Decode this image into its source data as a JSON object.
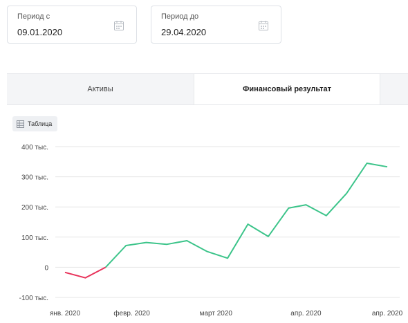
{
  "filters": {
    "from": {
      "label": "Период с",
      "value": "09.01.2020"
    },
    "to": {
      "label": "Период до",
      "value": "29.04.2020"
    }
  },
  "tabs": [
    {
      "label": "Активы",
      "active": false
    },
    {
      "label": "Финансовый результат",
      "active": true
    },
    {
      "label": "",
      "active": false
    }
  ],
  "table_button": {
    "label": "Таблица",
    "icon": "table-icon"
  },
  "colors": {
    "positive": "#3cc48a",
    "negative": "#e8325a",
    "grid": "#e5e5e5"
  },
  "chart_data": {
    "type": "line",
    "title": "",
    "xlabel": "",
    "ylabel": "",
    "ylim": [
      -100000,
      400000
    ],
    "y_ticks": [
      {
        "value": 400000,
        "label": "400 тыс."
      },
      {
        "value": 300000,
        "label": "300 тыс."
      },
      {
        "value": 200000,
        "label": "200 тыс."
      },
      {
        "value": 100000,
        "label": "100 тыс."
      },
      {
        "value": 0,
        "label": "0"
      },
      {
        "value": -100000,
        "label": "-100 тыс."
      }
    ],
    "x_ticks": [
      {
        "date": "2020-01-09",
        "label": "янв. 2020"
      },
      {
        "date": "2020-02-01",
        "label": "февр. 2020"
      },
      {
        "date": "2020-03-01",
        "label": "март 2020"
      },
      {
        "date": "2020-04-01",
        "label": "апр. 2020"
      },
      {
        "date": "2020-04-29",
        "label": "апр. 2020"
      }
    ],
    "grid": true,
    "legend": "none",
    "series": [
      {
        "x": [
          "2020-01-09",
          "2020-01-16",
          "2020-01-23",
          "2020-01-30",
          "2020-02-06",
          "2020-02-13",
          "2020-02-20",
          "2020-02-27",
          "2020-03-05",
          "2020-03-12",
          "2020-03-19",
          "2020-03-26",
          "2020-04-01",
          "2020-04-08",
          "2020-04-15",
          "2020-04-22",
          "2020-04-29"
        ],
        "values": [
          -17000,
          -35000,
          0,
          72000,
          82000,
          76000,
          88000,
          52000,
          30000,
          143000,
          102000,
          196000,
          207000,
          171000,
          245000,
          345000,
          333000
        ]
      }
    ]
  }
}
